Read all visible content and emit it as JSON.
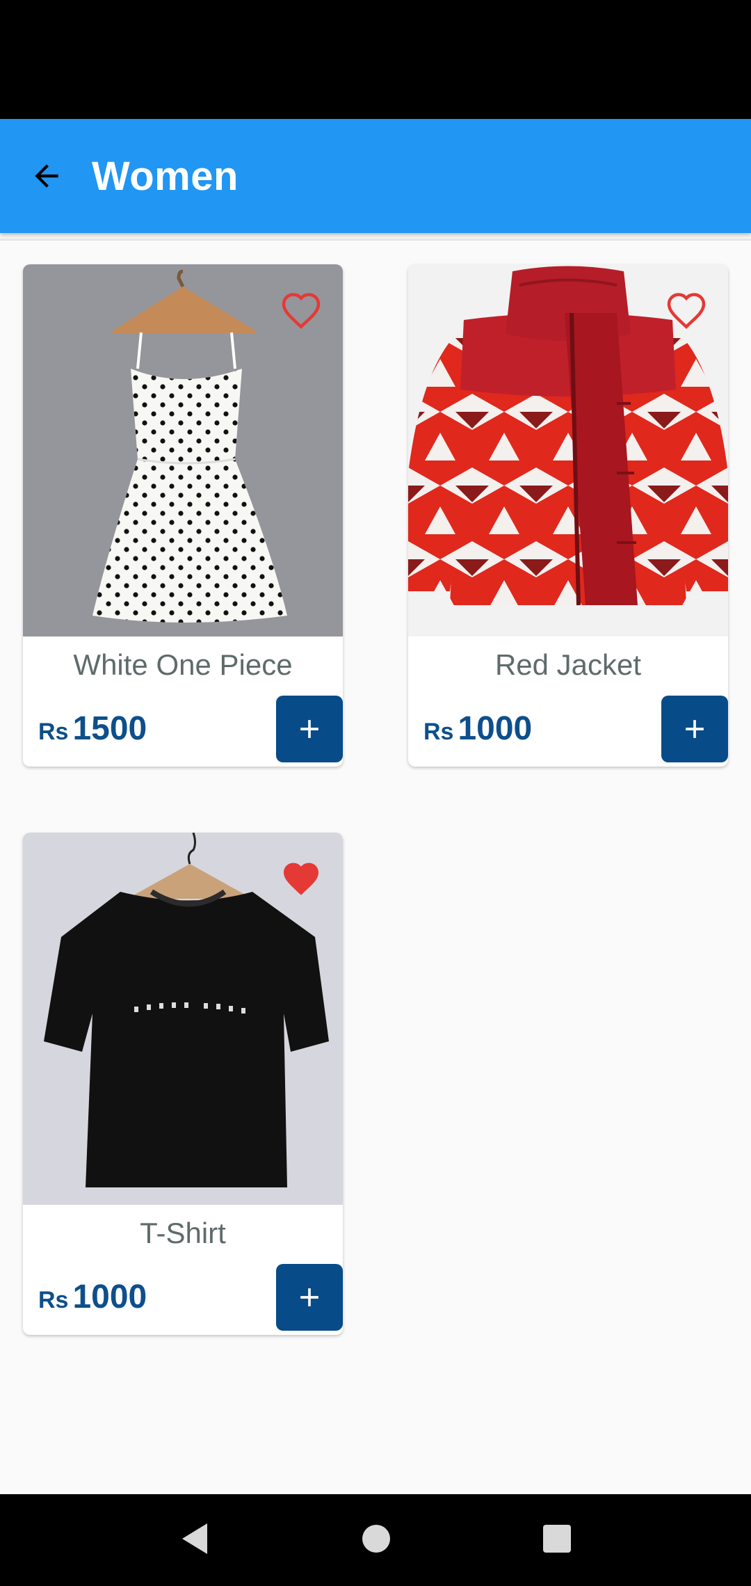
{
  "app_bar": {
    "title": "Women",
    "color": "#2196f3"
  },
  "products": [
    {
      "name": "White One Piece",
      "currency": "Rs",
      "price": "1500",
      "favorite": false,
      "image": "polka-dot-dress"
    },
    {
      "name": "Red Jacket",
      "currency": "Rs",
      "price": "1000",
      "favorite": false,
      "image": "red-puffer-jacket"
    },
    {
      "name": "T-Shirt",
      "currency": "Rs",
      "price": "1000",
      "favorite": true,
      "image": "black-tshirt"
    }
  ],
  "colors": {
    "price": "#0d4f8b",
    "add_button": "#084b89",
    "heart": "#e53935"
  },
  "nav_bar": {
    "icons": [
      "back-triangle-icon",
      "home-circle-icon",
      "recents-square-icon"
    ]
  }
}
